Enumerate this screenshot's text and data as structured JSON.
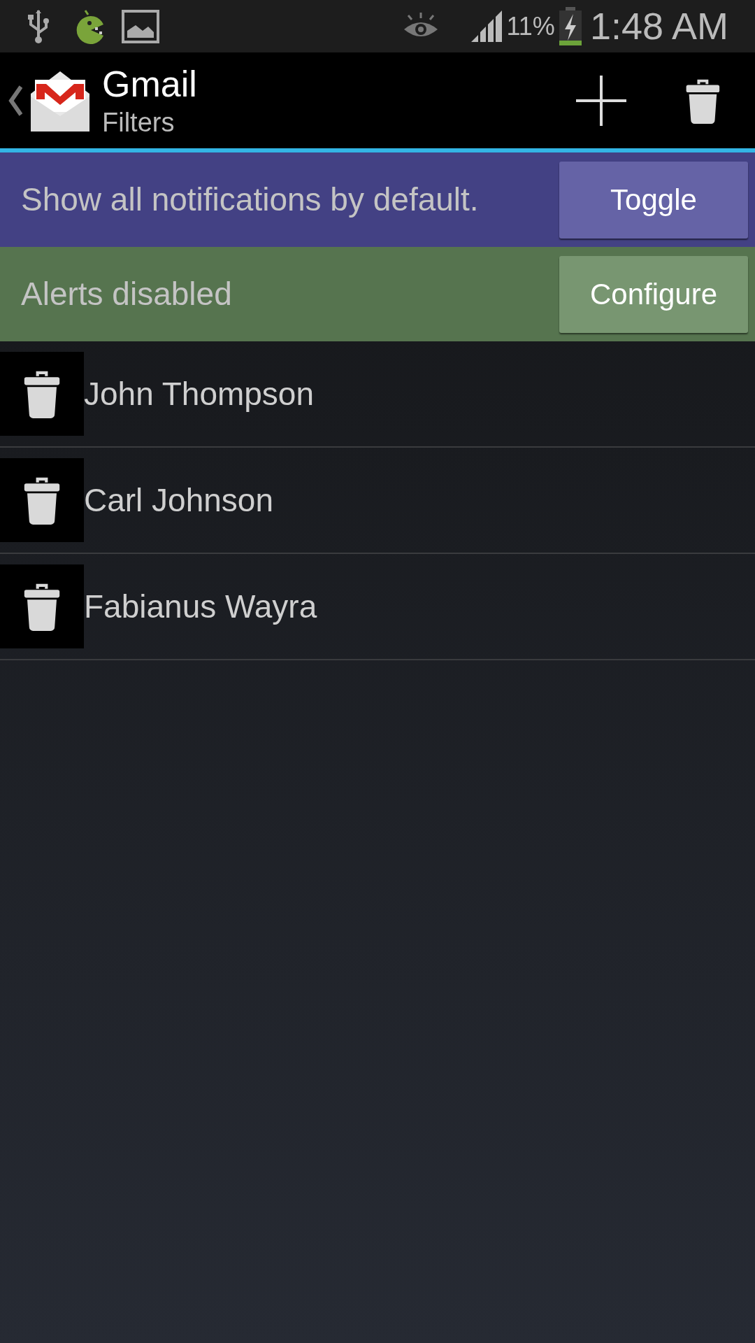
{
  "status_bar": {
    "battery": "11%",
    "time": "1:48 AM"
  },
  "action_bar": {
    "title": "Gmail",
    "subtitle": "Filters"
  },
  "banners": [
    {
      "text": "Show all notifications by default.",
      "button": "Toggle",
      "color": "#434184"
    },
    {
      "text": "Alerts disabled",
      "button": "Configure",
      "color": "#56744f"
    }
  ],
  "filters": [
    {
      "name": "John Thompson"
    },
    {
      "name": "Carl Johnson"
    },
    {
      "name": "Fabianus Wayra"
    }
  ]
}
